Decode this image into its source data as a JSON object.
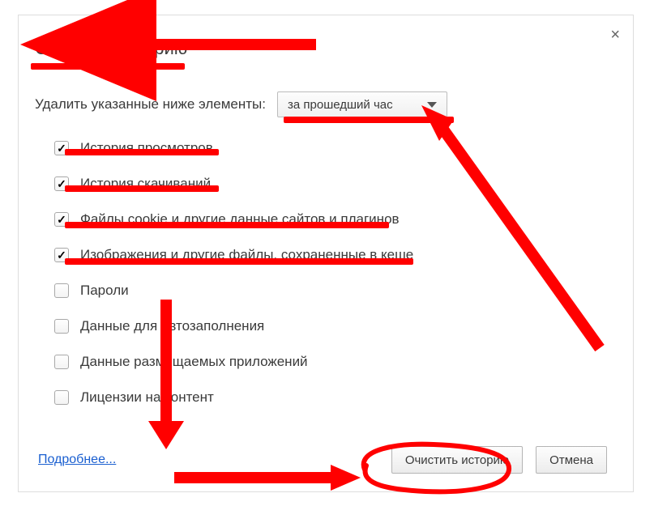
{
  "dialog": {
    "title": "Очистить историю",
    "delete_label": "Удалить указанные ниже элементы:",
    "timerange": "за прошедший час",
    "more_link": "Подробнее...",
    "clear_button": "Очистить историю",
    "cancel_button": "Отмена"
  },
  "items": [
    {
      "label": "История просмотров",
      "checked": true
    },
    {
      "label": "История скачиваний",
      "checked": true
    },
    {
      "label": "Файлы cookie и другие данные сайтов и плагинов",
      "checked": true
    },
    {
      "label": "Изображения и другие файлы, сохраненные в кеше",
      "checked": true
    },
    {
      "label": "Пароли",
      "checked": false
    },
    {
      "label": "Данные для автозаполнения",
      "checked": false
    },
    {
      "label": "Данные размещаемых приложений",
      "checked": false
    },
    {
      "label": "Лицензии на контент",
      "checked": false
    }
  ]
}
